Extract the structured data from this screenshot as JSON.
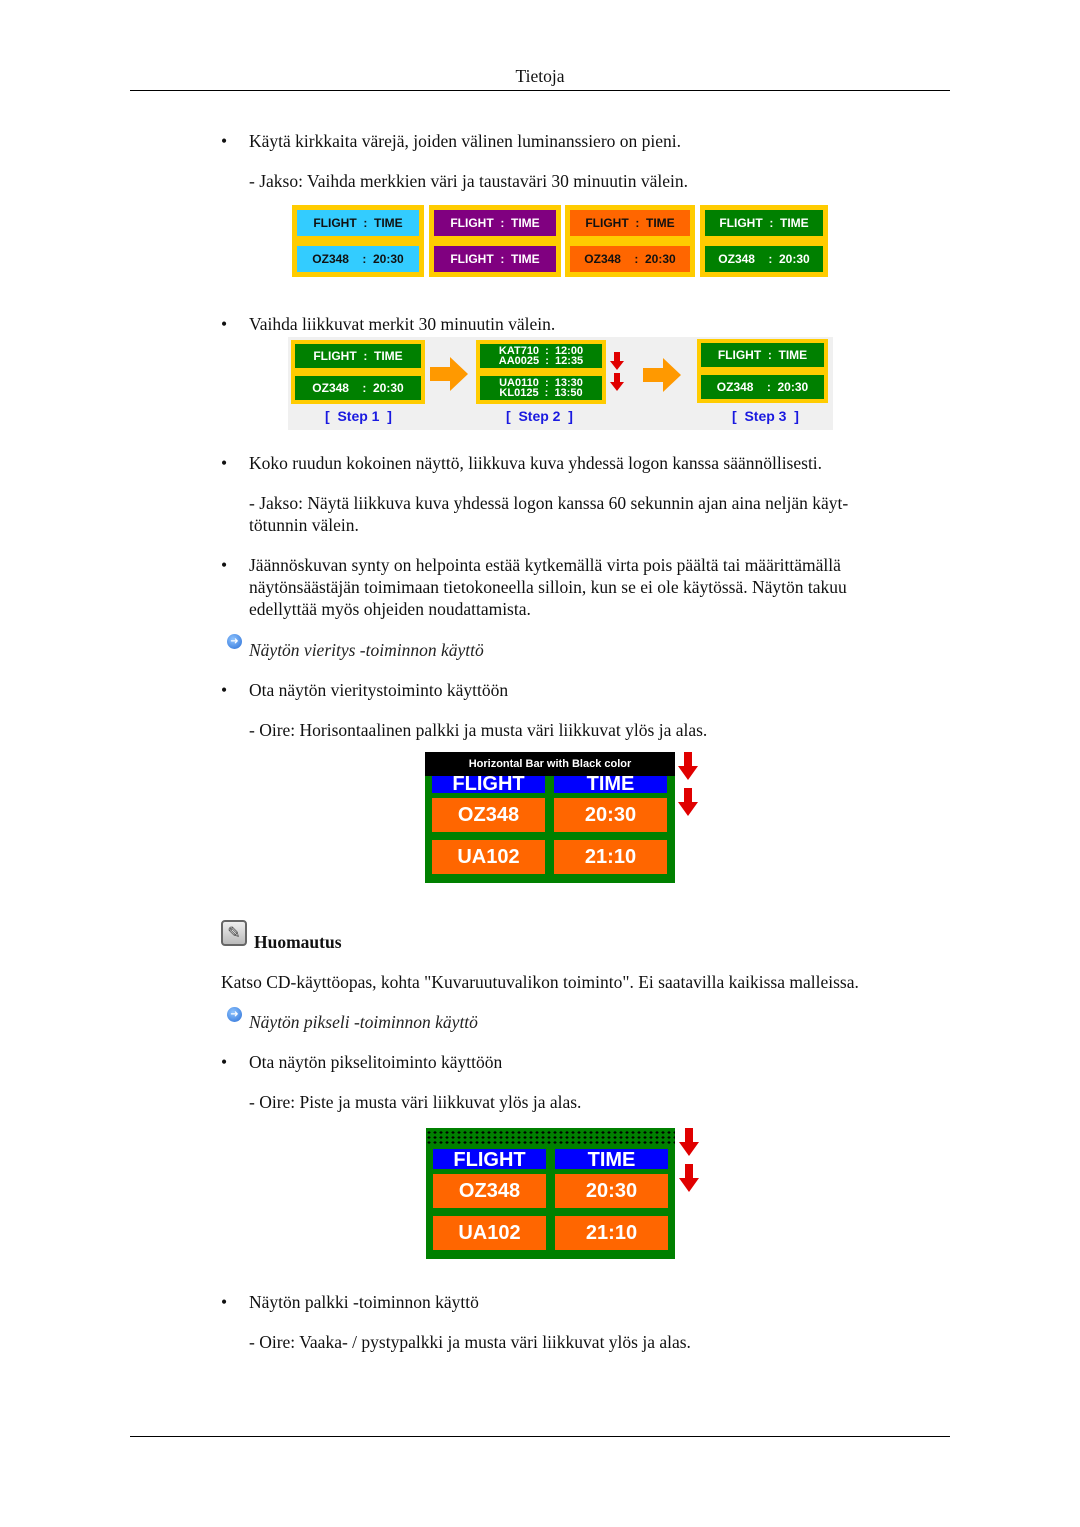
{
  "header": {
    "title": "Tietoja"
  },
  "colors": {
    "yellow": "#ffcc00",
    "cyan": "#33ccff",
    "purple": "#800080",
    "orange": "#ff6600",
    "green": "#008000",
    "blue": "#0000ff",
    "step": "#1a1ae0",
    "red": "#e00000"
  },
  "items": {
    "b1": "Käytä kirkkaita värejä, joiden välinen luminanssiero on pieni.",
    "b1_sub": "- Jakso: Vaihda merkkien väri ja taustaväri 30 minuutin välein.",
    "b2": "Vaihda liikkuvat merkit 30 minuutin välein.",
    "b3": "Koko ruudun kokoinen näyttö, liikkuva kuva yhdessä logon kanssa säännöllisesti.",
    "b3_sub1": "- Jakso: Näytä liikkuva kuva yhdessä logon kanssa 60 sekunnin ajan aina neljän käyt-",
    "b3_sub2": "tötunnin välein.",
    "b4_1": "Jäännöskuvan synty on helpointa estää kytkemällä virta pois päältä tai määrittämällä",
    "b4_2": "näytönsäästäjän toimimaan tietokoneella silloin, kun se ei ole käytössä. Näytön takuu",
    "b4_3": "edellyttää myös ohjeiden noudattamista.",
    "link1": "Näytön vieritys -toiminnon käyttö",
    "b5": "Ota näytön vieritystoiminto käyttöön",
    "b5_sub": "- Oire: Horisontaalinen palkki ja musta väri liikkuvat ylös ja alas.",
    "note_title": "Huomautus",
    "note_text": "Katso CD-käyttöopas, kohta \"Kuvaruutuvalikon toiminto\". Ei saatavilla kaikissa malleissa.",
    "link2": "Näytön pikseli -toiminnon käyttö",
    "b6": "Ota näytön pikselitoiminto käyttöön",
    "b6_sub": "- Oire: Piste ja musta väri liikkuvat ylös ja alas.",
    "b7": "Näytön palkki -toiminnon käyttö",
    "b7_sub": "- Oire: Vaaka- / pystypalkki ja musta väri liikkuvat ylös ja alas."
  },
  "bullet": "•",
  "fig1": [
    {
      "top": "FLIGHT  :  TIME",
      "bottom": "OZ348    :  20:30",
      "bg": "#33ccff",
      "fg": "#111111"
    },
    {
      "top": "FLIGHT  :  TIME",
      "bottom": "FLIGHT  :  TIME",
      "bg": "#800080",
      "fg": "#ffffff"
    },
    {
      "top": "FLIGHT  :  TIME",
      "bottom": "OZ348    :  20:30",
      "bg": "#ff6600",
      "fg": "#111111"
    },
    {
      "top": "FLIGHT  :  TIME",
      "bottom": "OZ348    :  20:30",
      "bg": "#008000",
      "fg": "#ffffff"
    }
  ],
  "fig2": {
    "step1": {
      "top": "FLIGHT  :  TIME",
      "bottom": "OZ348    :  20:30",
      "label": "[  Step 1  ]"
    },
    "step2": {
      "top": "KAT710  :  12:00",
      "top2": "AA0025  :  12:35",
      "bottom": "UA0110  :  13:30",
      "bottom2": "KL0125  :  13:50",
      "label": "[  Step 2  ]"
    },
    "step3": {
      "top": "FLIGHT  :  TIME",
      "bottom": "OZ348    :  20:30",
      "label": "[  Step 3  ]"
    }
  },
  "fig3": {
    "banner": "Horizontal Bar with Black color",
    "cells": [
      "FLIGHT",
      "TIME",
      "OZ348",
      "20:30",
      "UA102",
      "21:10"
    ]
  },
  "fig4": {
    "cells": [
      "FLIGHT",
      "TIME",
      "OZ348",
      "20:30",
      "UA102",
      "21:10"
    ]
  }
}
